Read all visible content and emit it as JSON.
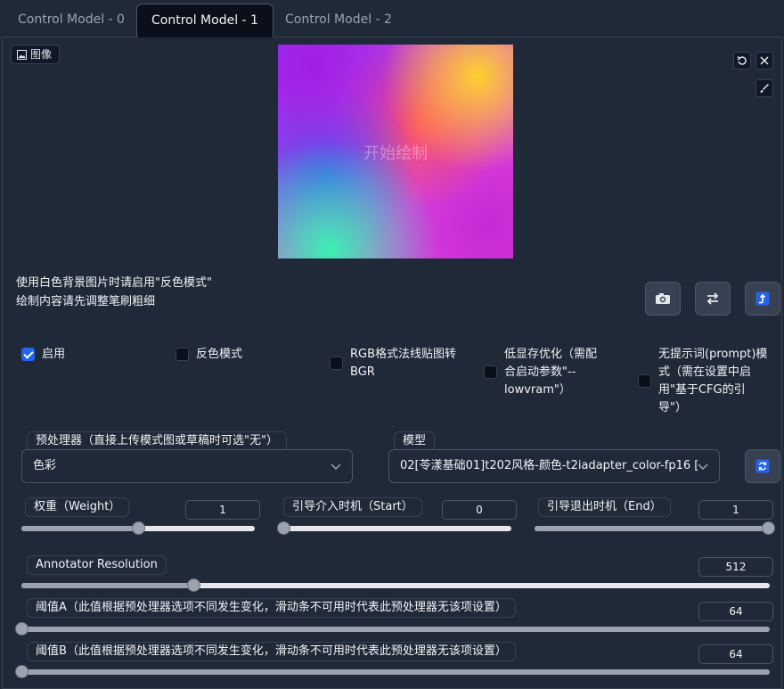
{
  "tabs": [
    {
      "label": "Control Model - 0"
    },
    {
      "label": "Control Model - 1",
      "active": true
    },
    {
      "label": "Control Model - 2"
    }
  ],
  "image_block": {
    "label": "图像",
    "canvas_text": "开始绘制"
  },
  "hints": {
    "line1": "使用白色背景图片时请启用\"反色模式\"",
    "line2": "绘制内容请先调整笔刷粗细"
  },
  "checkboxes": [
    {
      "label": "启用",
      "checked": true
    },
    {
      "label": "反色模式",
      "checked": false
    },
    {
      "label_lines": [
        "RGB格式法线贴图转",
        "BGR"
      ],
      "checked": false
    },
    {
      "label_lines": [
        "低显存优化（需配",
        "合启动参数\"--",
        "lowvram\"）"
      ],
      "checked": false
    },
    {
      "label_lines": [
        "无提示词(prompt)模",
        "式（需在设置中启",
        "用\"基于CFG的引",
        "导\"）"
      ],
      "checked": false
    }
  ],
  "preprocessor": {
    "label": "预处理器（直接上传模式图或草稿时可选\"无\"）",
    "value": "色彩"
  },
  "model": {
    "label": "模型",
    "value": "02[苓漾基础01]t202风格-颜色-t2iadapter_color-fp16 ["
  },
  "weight": {
    "label": "权重（Weight）",
    "value": "1",
    "fraction": 0.5
  },
  "start": {
    "label": "引导介入时机（Start）",
    "value": "0",
    "fraction": 0.0
  },
  "end": {
    "label": "引导退出时机（End）",
    "value": "1",
    "fraction": 1.0
  },
  "annotator": {
    "label": "Annotator Resolution",
    "value": "512",
    "fraction": 0.23
  },
  "threshold_a": {
    "label": "阈值A（此值根据预处理器选项不同发生变化，滑动条不可用时代表此预处理器无该项设置）",
    "value": "64",
    "fraction": 0.0
  },
  "threshold_b": {
    "label": "阈值B（此值根据预处理器选项不同发生变化，滑动条不可用时代表此预处理器无该项设置）",
    "value": "64",
    "fraction": 0.0
  },
  "icons": {
    "image": "image-icon",
    "undo": "undo-icon",
    "close": "close-icon",
    "brush": "brush-icon",
    "camera": "camera-icon",
    "swap": "swap-icon",
    "send": "send-dimensions-icon",
    "refresh": "refresh-icon"
  },
  "colors": {
    "accent": "#2563eb",
    "background": "#1f2937"
  }
}
